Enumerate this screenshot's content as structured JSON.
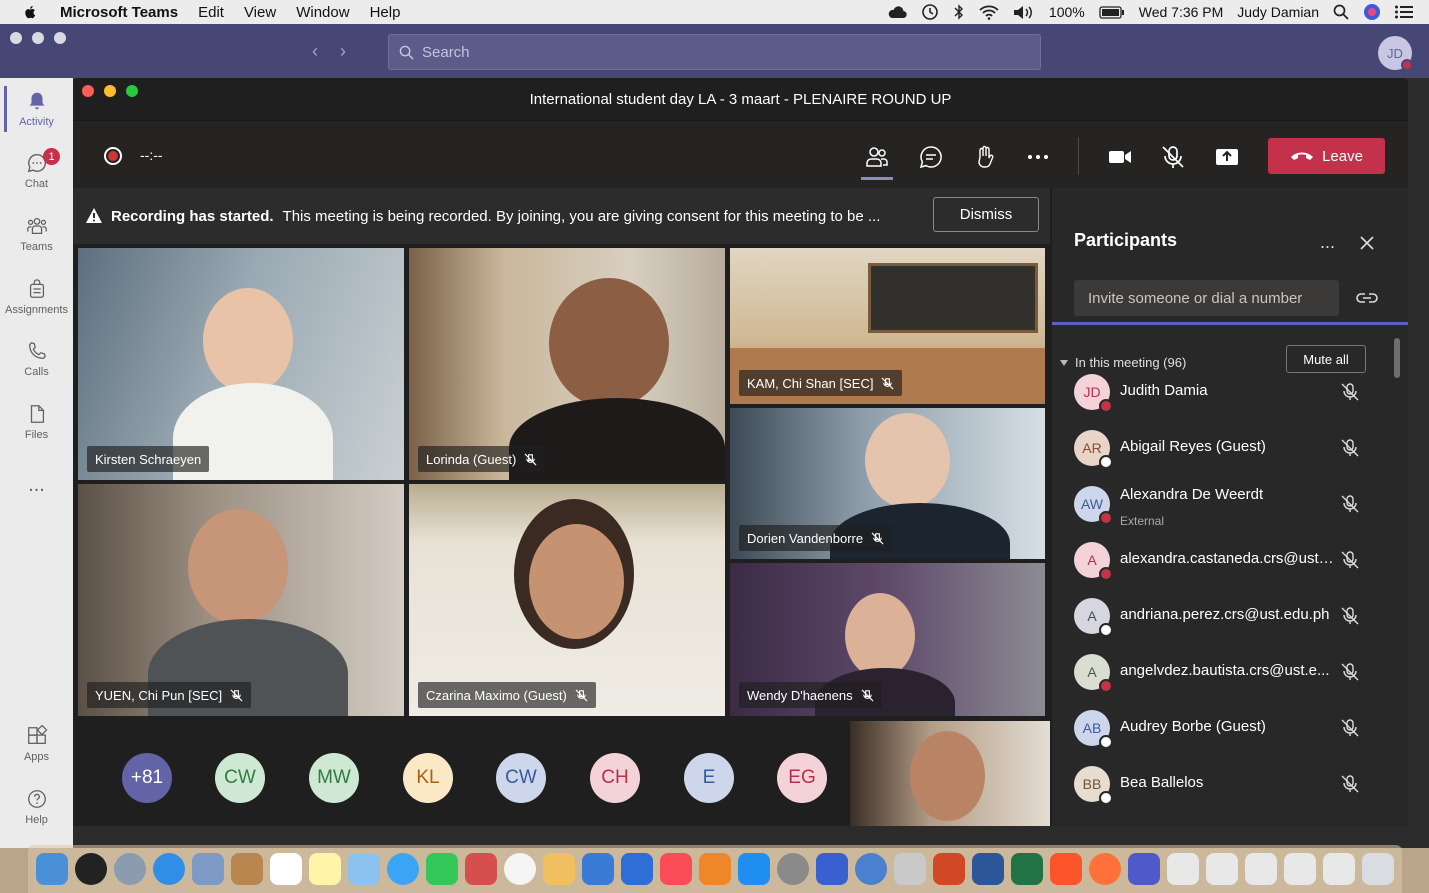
{
  "menubar": {
    "app_name": "Microsoft Teams",
    "items": [
      "Edit",
      "View",
      "Window",
      "Help"
    ],
    "battery": "100%",
    "clock": "Wed 7:36 PM",
    "user": "Judy Damian"
  },
  "search": {
    "placeholder": "Search"
  },
  "me": {
    "initials": "JD"
  },
  "rail": {
    "items": [
      {
        "label": "Activity",
        "icon": "bell-icon"
      },
      {
        "label": "Chat",
        "icon": "chat-icon",
        "badge": "1"
      },
      {
        "label": "Teams",
        "icon": "teams-icon"
      },
      {
        "label": "Assignments",
        "icon": "assignments-icon"
      },
      {
        "label": "Calls",
        "icon": "phone-icon"
      },
      {
        "label": "Files",
        "icon": "file-icon"
      },
      {
        "label": "...",
        "icon": "more-icon"
      },
      {
        "label": "Apps",
        "icon": "apps-icon"
      },
      {
        "label": "Help",
        "icon": "help-icon"
      }
    ]
  },
  "meeting": {
    "title": "International student day LA - 3 maart - PLENAIRE ROUND UP",
    "timer": "--:--",
    "leave_label": "Leave",
    "banner_title": "Recording has started.",
    "banner_text": "This meeting is being recorded. By joining, you are giving consent for this meeting to be ...",
    "dismiss_label": "Dismiss"
  },
  "tiles": [
    {
      "name": "Kirsten Schraeyen"
    },
    {
      "name": "Lorinda (Guest)"
    },
    {
      "name": "KAM, Chi Shan [SEC]"
    },
    {
      "name": "Dorien Vandenborre"
    },
    {
      "name": "YUEN, Chi Pun [SEC]"
    },
    {
      "name": "Czarina Maximo (Guest)"
    },
    {
      "name": "Wendy D'haenens"
    }
  ],
  "strip": [
    {
      "initials": "+81",
      "bg": "#6264a7",
      "fg": "#ffffff"
    },
    {
      "initials": "CW",
      "bg": "#cfe8d3",
      "fg": "#2e7d42"
    },
    {
      "initials": "MW",
      "bg": "#cfe8d3",
      "fg": "#2e7d42"
    },
    {
      "initials": "KL",
      "bg": "#fbe8c5",
      "fg": "#a4631b"
    },
    {
      "initials": "CW",
      "bg": "#cdd6ea",
      "fg": "#3a5b9a"
    },
    {
      "initials": "CH",
      "bg": "#f4d3d8",
      "fg": "#b2324a"
    },
    {
      "initials": "E",
      "bg": "#cdd6ea",
      "fg": "#3a5b9a"
    },
    {
      "initials": "EG",
      "bg": "#f4d3d8",
      "fg": "#b2324a"
    }
  ],
  "panel": {
    "title": "Participants",
    "more": "...",
    "invite_placeholder": "Invite someone or dial a number",
    "in_meeting": "In this meeting (96)",
    "mute_all": "Mute all",
    "people": [
      {
        "initials": "JD",
        "name": "Judith Damia",
        "sub": "",
        "bg": "#f4d3d8",
        "fg": "#b2324a",
        "status": "#c4314b"
      },
      {
        "initials": "AR",
        "name": "Abigail Reyes (Guest)",
        "sub": "",
        "bg": "#e8d4c8",
        "fg": "#8a4b2e",
        "status": "#ffffff"
      },
      {
        "initials": "AW",
        "name": "Alexandra De Weerdt",
        "sub": "External",
        "bg": "#cdd6ea",
        "fg": "#3a5b9a",
        "status": "#c4314b"
      },
      {
        "initials": "A",
        "name": "alexandra.castaneda.crs@ust....",
        "sub": "",
        "bg": "#f4d3d8",
        "fg": "#b2324a",
        "status": "#c4314b"
      },
      {
        "initials": "A",
        "name": "andriana.perez.crs@ust.edu.ph",
        "sub": "",
        "bg": "#d5d6e0",
        "fg": "#4a4b63",
        "status": "#ffffff"
      },
      {
        "initials": "A",
        "name": "angelvdez.bautista.crs@ust.e...",
        "sub": "",
        "bg": "#d9ddd2",
        "fg": "#4d5a3c",
        "status": "#c4314b"
      },
      {
        "initials": "AB",
        "name": "Audrey Borbe (Guest)",
        "sub": "",
        "bg": "#cdd6ea",
        "fg": "#3a5b9a",
        "status": "#ffffff"
      },
      {
        "initials": "BB",
        "name": "Bea Ballelos",
        "sub": "",
        "bg": "#e6dccf",
        "fg": "#6f5234",
        "status": "#ffffff"
      }
    ]
  }
}
